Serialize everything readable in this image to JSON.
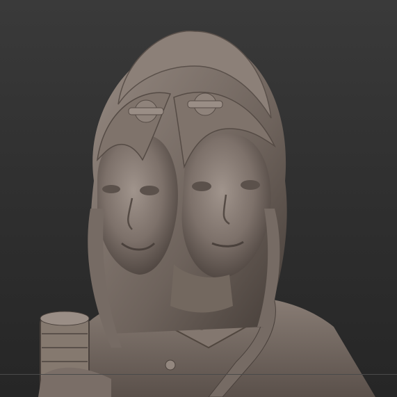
{
  "viewport": {
    "background_top": "#3a3a3a",
    "background_bottom": "#262626",
    "material_color": "#7d716a",
    "material_shadow": "#4a413c",
    "material_highlight": "#a0948c",
    "floor_line_color": "#4a4a4a"
  },
  "model": {
    "description_icon": "sculpt-bust-icon"
  }
}
